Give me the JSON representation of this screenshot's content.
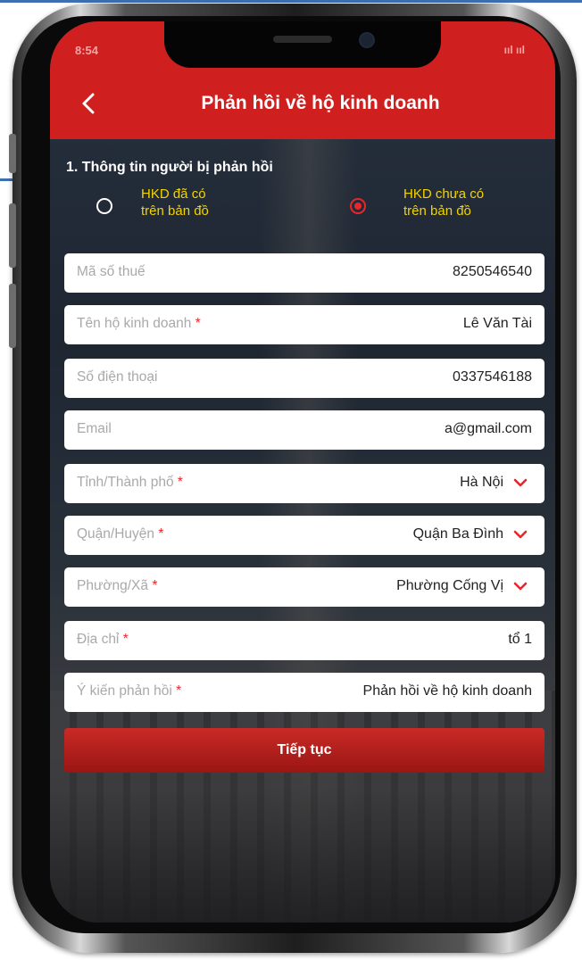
{
  "status_bar": {
    "time": "8:54",
    "right": "ııl ııl"
  },
  "header": {
    "back_icon": "chevron-left-icon",
    "title": "Phản hồi về hộ kinh doanh"
  },
  "section": {
    "title": "1. Thông tin người bị phản hồi"
  },
  "radio_options": [
    {
      "line1": "HKD đã có",
      "line2": "trên bản đồ",
      "checked": false
    },
    {
      "line1": "HKD chưa có",
      "line2": "trên bản đồ",
      "checked": true
    }
  ],
  "fields": [
    {
      "label": "Mã số thuế",
      "required": false,
      "value": "8250546540",
      "type": "text"
    },
    {
      "label": "Tên hộ kinh doanh",
      "required": true,
      "value": "Lê Văn Tài",
      "type": "text"
    },
    {
      "label": "Số điện thoại",
      "required": false,
      "value": "0337546188",
      "type": "text"
    },
    {
      "label": "Email",
      "required": false,
      "value": "a@gmail.com",
      "type": "text"
    },
    {
      "label": "Tỉnh/Thành phố",
      "required": true,
      "value": "Hà Nội",
      "type": "select"
    },
    {
      "label": "Quận/Huyện",
      "required": true,
      "value": "Quận Ba Đình",
      "type": "select"
    },
    {
      "label": "Phường/Xã",
      "required": true,
      "value": "Phường Cống Vị",
      "type": "select"
    },
    {
      "label": "Địa chỉ",
      "required": true,
      "value": "tổ 1",
      "type": "text"
    },
    {
      "label": "Ý kiến phản hồi",
      "required": true,
      "value": "Phản hồi về hộ kinh doanh",
      "type": "text"
    }
  ],
  "required_marker": "*",
  "continue_label": "Tiếp tục",
  "colors": {
    "header_red": "#cf1f1f",
    "radio_label_yellow": "#f2d400",
    "required_red": "#e8262b",
    "button_red": "#c92a26"
  }
}
